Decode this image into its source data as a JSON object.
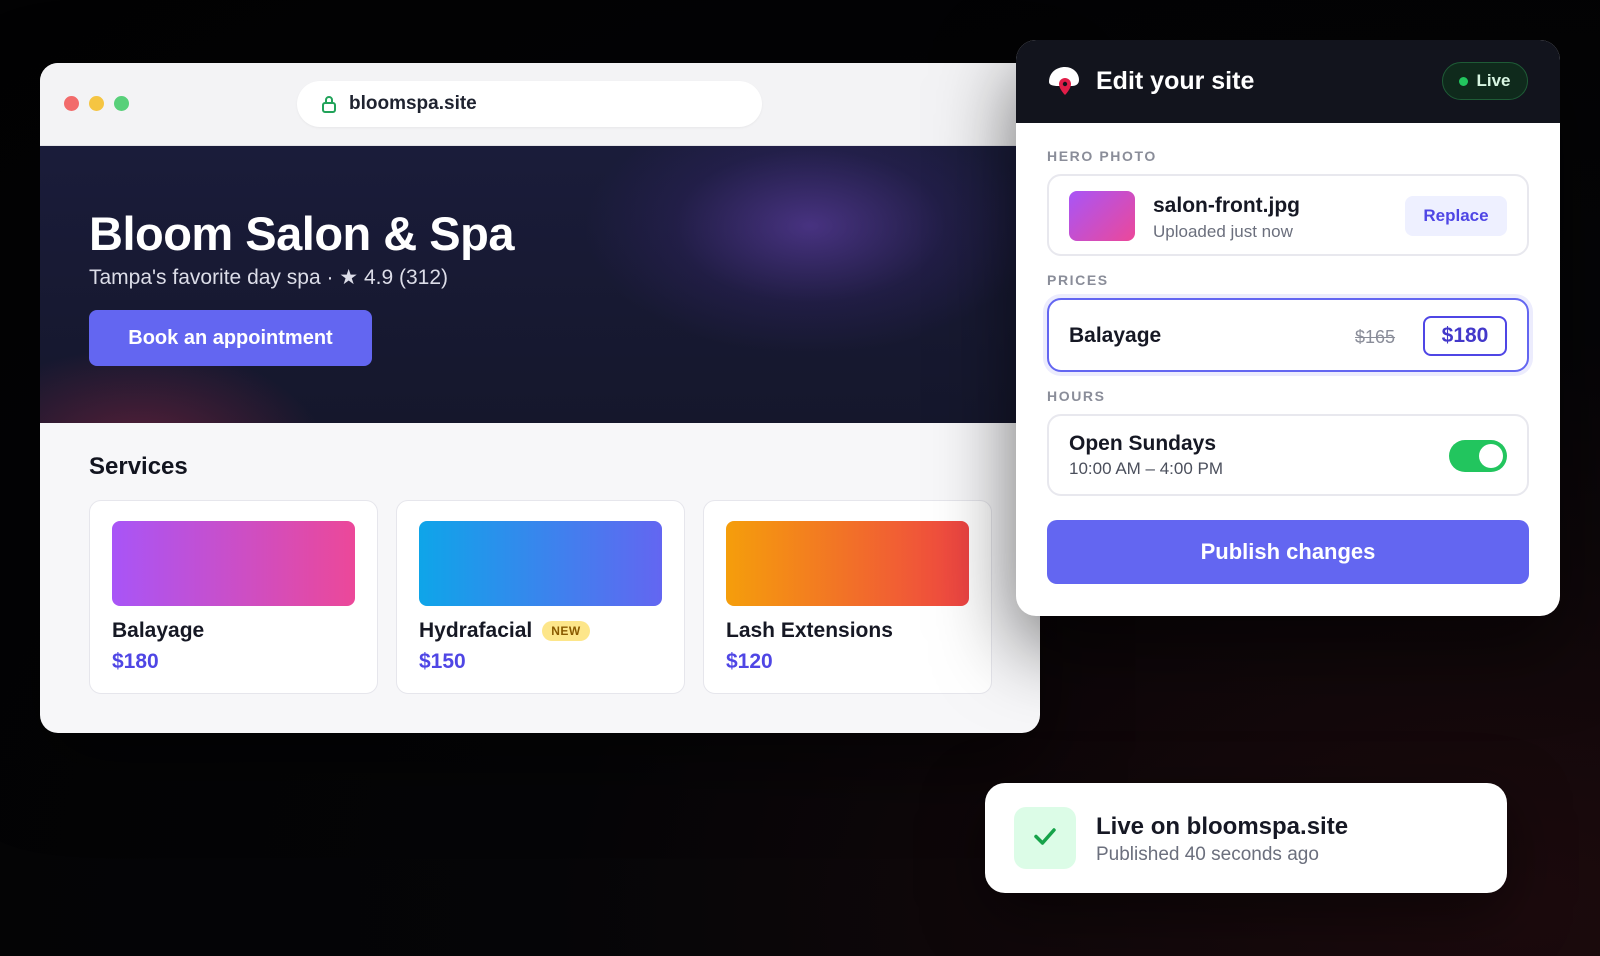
{
  "browser": {
    "url": "bloomspa.site",
    "icons": {
      "lock": "lock-icon"
    }
  },
  "hero": {
    "title": "Bloom Salon & Spa",
    "subtitle": "Tampa's favorite day spa · ★ 4.9 (312)",
    "cta_label": "Book an appointment"
  },
  "services": {
    "title": "Services",
    "items": [
      {
        "name": "Balayage",
        "price": "$180",
        "badge": "",
        "gradient": [
          "#a855f7",
          "#ec4899"
        ]
      },
      {
        "name": "Hydrafacial",
        "price": "$150",
        "badge": "NEW",
        "gradient": [
          "#0ea5e9",
          "#6366f1"
        ]
      },
      {
        "name": "Lash Extensions",
        "price": "$120",
        "badge": "",
        "gradient": [
          "#f59e0b",
          "#ef4444"
        ]
      }
    ]
  },
  "editor": {
    "title": "Edit your site",
    "status": "Live",
    "hero_photo": {
      "label": "HERO PHOTO",
      "file_name": "salon-front.jpg",
      "file_status": "Uploaded just now",
      "replace_label": "Replace"
    },
    "prices": {
      "label": "PRICES",
      "item_name": "Balayage",
      "old_price": "$165",
      "new_price": "$180"
    },
    "hours": {
      "label": "HOURS",
      "title": "Open Sundays",
      "range": "10:00 AM – 4:00 PM",
      "enabled": true
    },
    "publish_label": "Publish changes"
  },
  "toast": {
    "title": "Live on bloomspa.site",
    "subtitle": "Published 40 seconds ago",
    "icon": "check-icon"
  },
  "colors": {
    "accent": "#6366f1",
    "live_green": "#22c55e",
    "price_text": "#4f46e5"
  }
}
